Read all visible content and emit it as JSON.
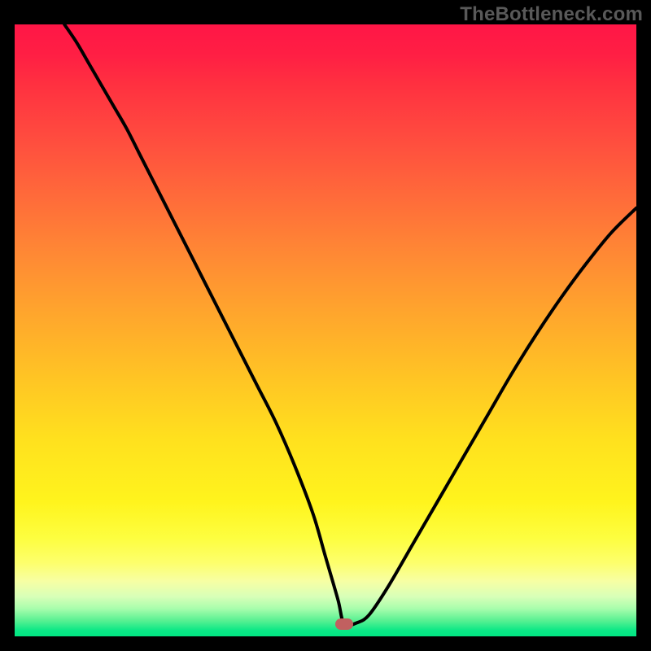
{
  "watermark": "TheBottleneck.com",
  "colors": {
    "background": "#000000",
    "watermark_text": "#595959",
    "curve_stroke": "#000000",
    "marker_fill": "#c16060",
    "gradient_top": "#ff1646",
    "gradient_bottom": "#00e582"
  },
  "chart_data": {
    "type": "line",
    "title": "",
    "xlabel": "",
    "ylabel": "",
    "xlim": [
      0,
      100
    ],
    "ylim": [
      0,
      100
    ],
    "grid": false,
    "legend": false,
    "marker": {
      "x": 53,
      "y": 2
    },
    "series": [
      {
        "name": "bottleneck-curve",
        "x": [
          8,
          10,
          12,
          14,
          16,
          18,
          20,
          22,
          24,
          27,
          30,
          33,
          36,
          39,
          42,
          45,
          48,
          50,
          52,
          53,
          55,
          57,
          60,
          64,
          68,
          72,
          76,
          80,
          84,
          88,
          92,
          96,
          100
        ],
        "y": [
          100,
          97,
          93.5,
          90,
          86.5,
          83,
          79,
          75,
          71,
          65,
          59,
          53,
          47,
          41,
          35,
          28,
          20,
          13,
          6,
          2,
          2.2,
          3.5,
          8,
          15,
          22,
          29,
          36,
          43,
          49.5,
          55.5,
          61,
          66,
          70
        ]
      }
    ]
  }
}
